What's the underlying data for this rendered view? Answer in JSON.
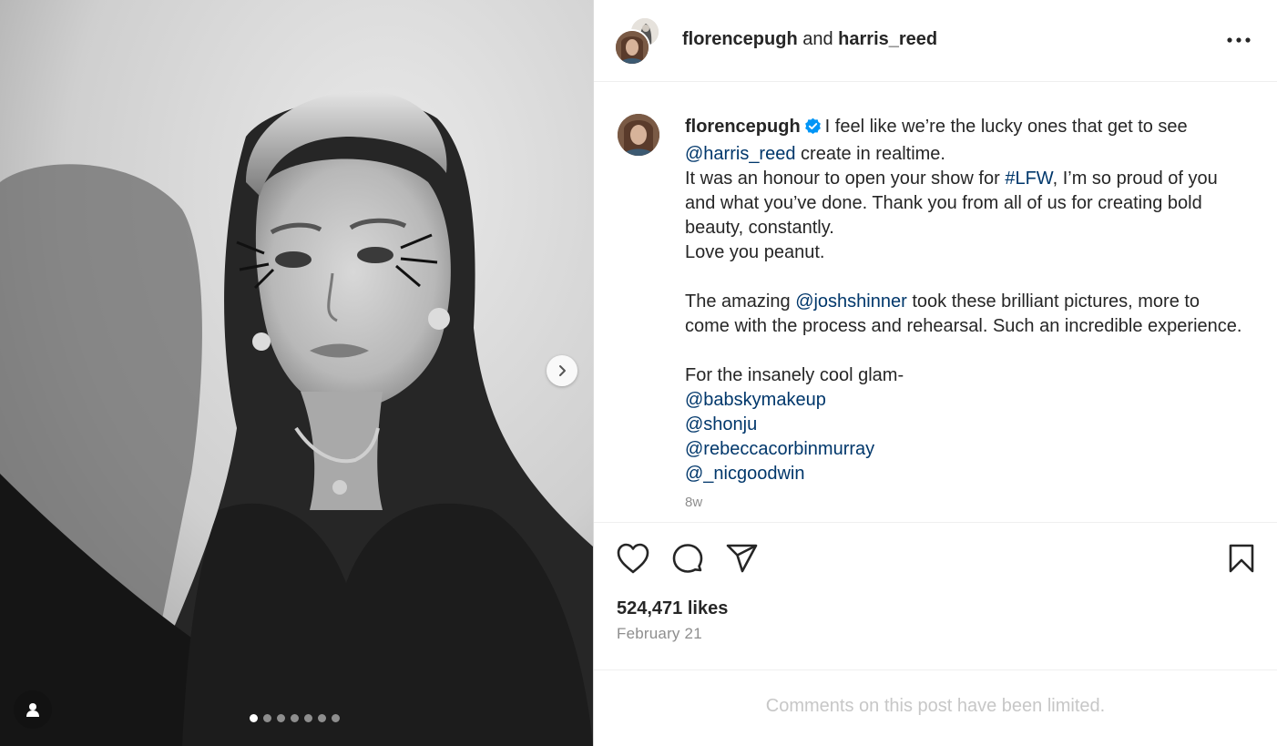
{
  "media": {
    "slide_count": 7,
    "active_slide": 1,
    "next_icon": "chevron-right-icon",
    "tag_icon": "user-icon"
  },
  "header": {
    "user1": "florencepugh",
    "joiner": "and",
    "user2": "harris_reed",
    "more_icon": "more-horizontal-icon"
  },
  "caption": {
    "author": "florencepugh",
    "verified_icon": "verified-badge-icon",
    "line1_text": "I feel like we’re the lucky ones that get to see",
    "line2_link": "@harris_reed",
    "line2_text": "create in realtime.",
    "line3_text_a": "It was an honour to open your show for",
    "line3_link": "#LFW",
    "line3_text_b": ", I’m so proud of you",
    "line4_text": "and what you’ve done. Thank you from all of us for creating bold",
    "line5_text": "beauty, constantly.",
    "line6_text": "Love you peanut.",
    "line7_text_a": "The amazing",
    "line7_link": "@joshshinner",
    "line7_text_b": "took these brilliant pictures, more to",
    "line8_text": "come with the process and rehearsal. Such an incredible experience.",
    "line9_text": "For the insanely cool glam-",
    "mentions": [
      "@babskymakeup",
      "@shonju",
      "@rebeccacorbinmurray",
      "@_nicgoodwin"
    ],
    "time_ago": "8w"
  },
  "actions": {
    "like_icon": "heart-icon",
    "comment_icon": "comment-icon",
    "share_icon": "send-icon",
    "save_icon": "bookmark-icon"
  },
  "likes": "524,471 likes",
  "date": "February 21",
  "comments_limited": "Comments on this post have been limited.",
  "colors": {
    "link": "#00376b",
    "verified": "#0095f6",
    "secondary_text": "#8e8e8e",
    "limited_text": "#c7c7c7"
  }
}
